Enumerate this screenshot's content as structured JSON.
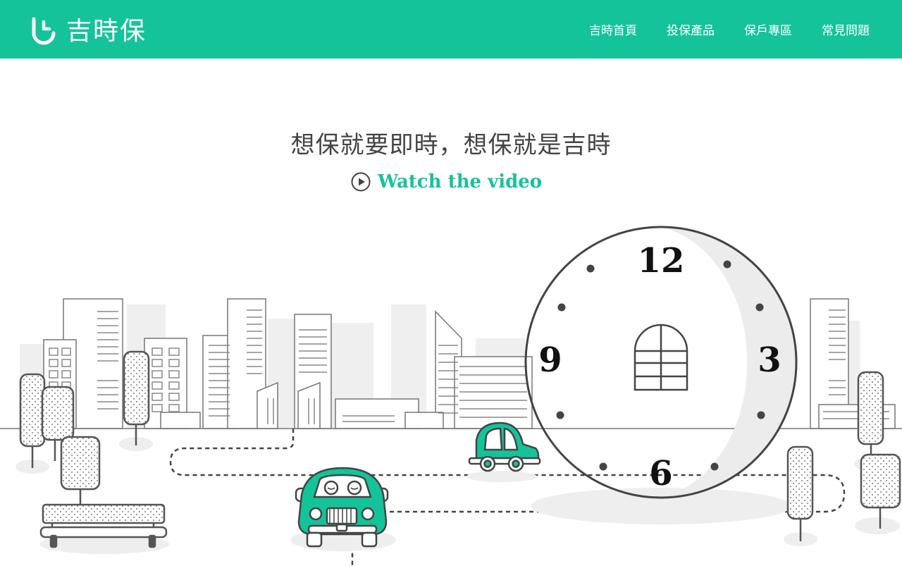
{
  "header": {
    "logo_text": "吉時保",
    "logo_icon": "clock-hook-icon",
    "nav": [
      {
        "label": "吉時首頁"
      },
      {
        "label": "投保產品"
      },
      {
        "label": "保戶專區"
      },
      {
        "label": "常見問題"
      }
    ]
  },
  "hero": {
    "headline": "想保就要即時，想保就是吉時",
    "video_label": "Watch the video",
    "video_icon": "play-circle-icon"
  },
  "clock": {
    "numbers": {
      "top": "12",
      "right": "3",
      "bottom": "6",
      "left": "9"
    }
  },
  "colors": {
    "brand": "#14c39a",
    "headline": "#444444",
    "line": "#4a4a4a"
  }
}
